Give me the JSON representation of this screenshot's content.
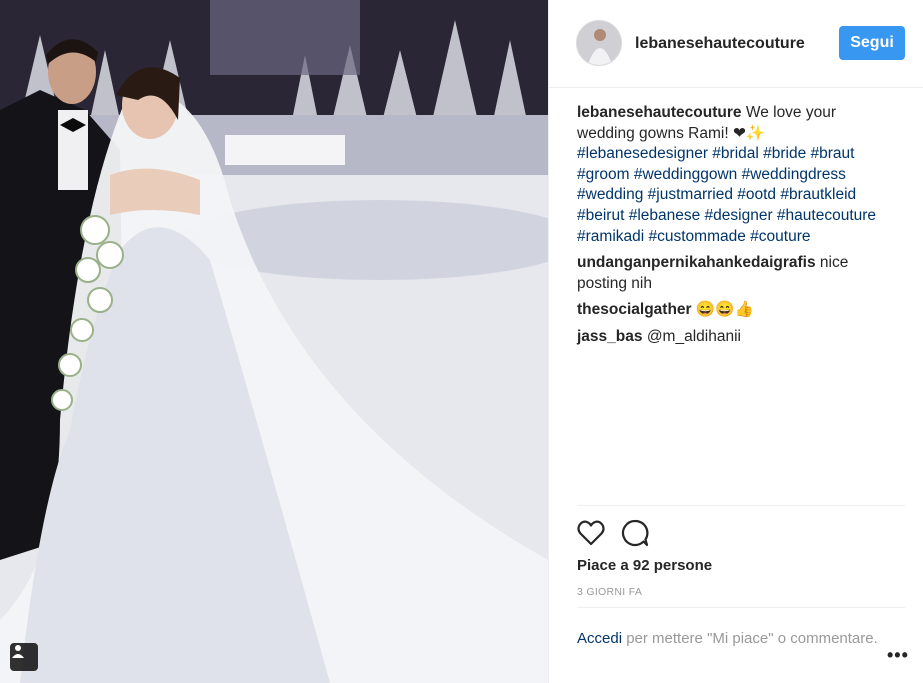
{
  "post": {
    "username": "lebanesehautecouture",
    "follow_label": "Segui",
    "caption": {
      "username": "lebanesehautecouture",
      "text": "We love your wedding gowns Rami! ❤✨",
      "hashtags": "#lebanesedesigner #bridal #bride #braut #groom #weddinggown #weddingdress #wedding #justmarried #ootd #brautkleid #beirut #lebanese #designer #hautecouture #ramikadi #custommade #couture"
    },
    "comments": [
      {
        "username": "undanganpernikahankedaigrafis",
        "text": "nice posting nih"
      },
      {
        "username": "thesocialgather",
        "text": "😄😄👍"
      },
      {
        "username": "jass_bas",
        "text": "@m_aldihanii"
      }
    ],
    "likes": "Piace a 92 persone",
    "timestamp": "3 GIORNI FA",
    "login_link": "Accedi",
    "login_text": " per mettere \"Mi piace\" o commentare.",
    "more_label": "•••"
  },
  "icons": {
    "like": "heart-icon",
    "comment": "comment-icon",
    "tag": "user-tag-icon",
    "more": "more-options-icon"
  },
  "colors": {
    "follow_bg": "#3897f0",
    "link": "#003569",
    "muted": "#999999"
  }
}
